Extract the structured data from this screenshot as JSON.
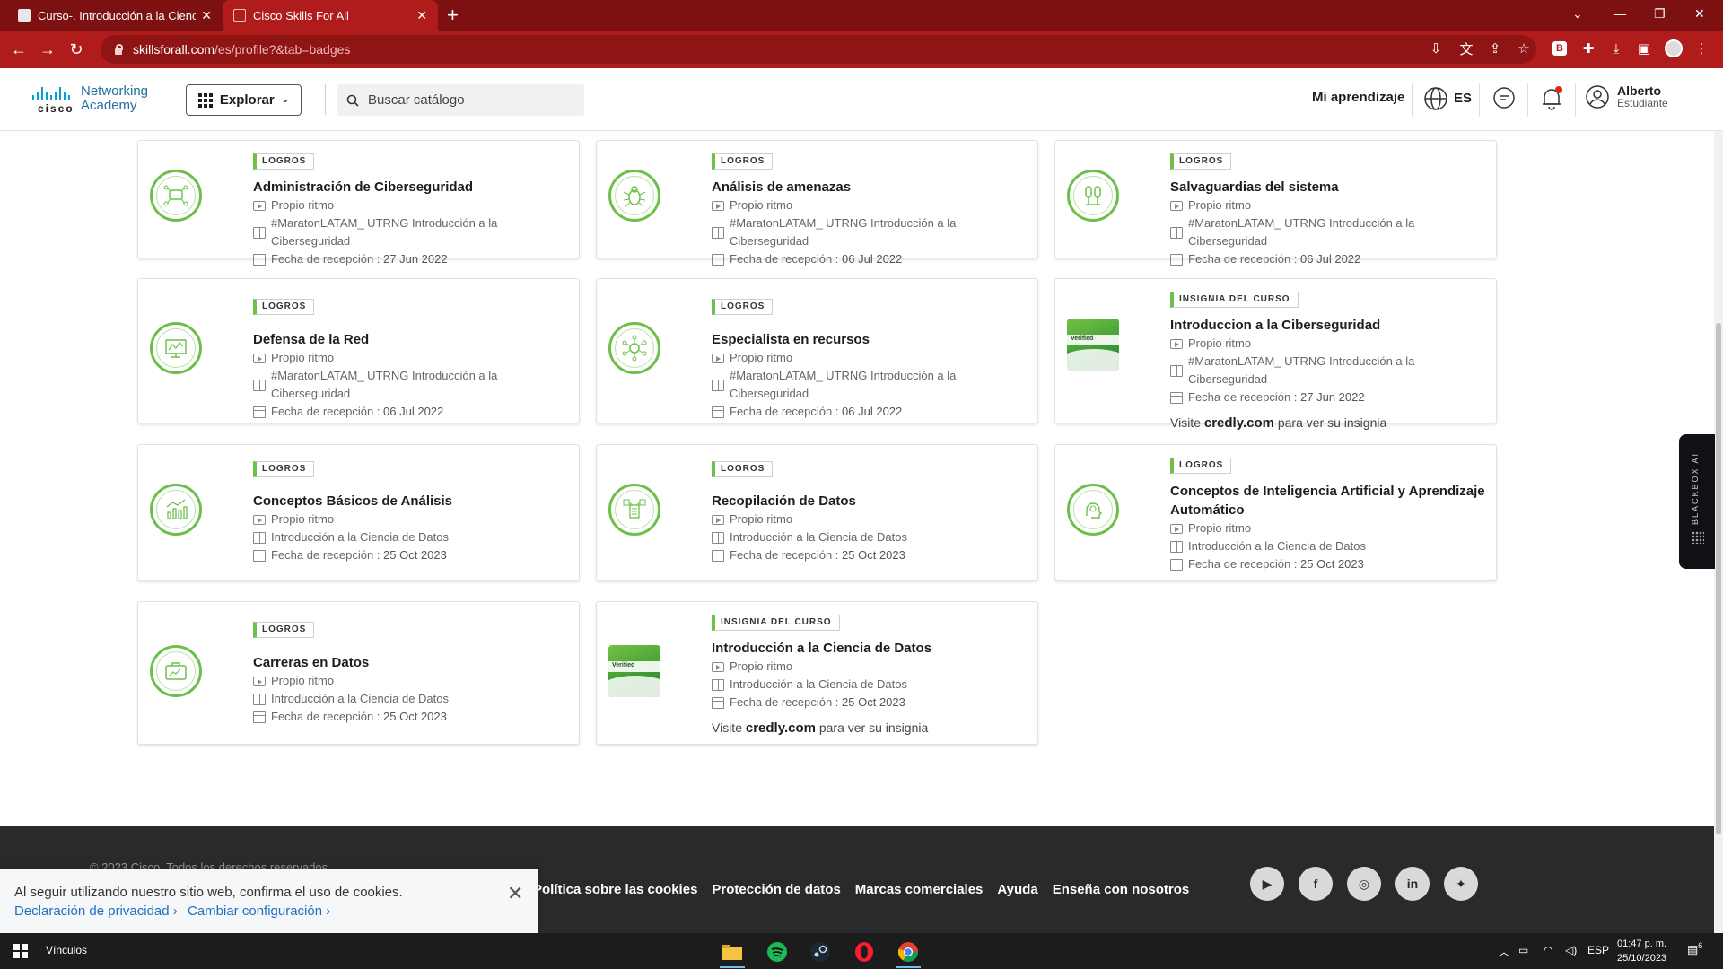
{
  "browser": {
    "tabs": [
      {
        "title": "Curso-. Introducción a la Ciencia",
        "active": false
      },
      {
        "title": "Cisco Skills For All",
        "active": true
      }
    ],
    "url_host": "skillsforall.com",
    "url_path": "/es/profile?&tab=badges",
    "accent_color": "#b01b1b"
  },
  "header": {
    "logo_word": "cisco",
    "logo_name_1": "Networking",
    "logo_name_2": "Academy",
    "explore_label": "Explorar",
    "search_placeholder": "Buscar catálogo",
    "my_learning": "Mi aprendizaje",
    "language": "ES",
    "user_name": "Alberto",
    "user_role": "Estudiante"
  },
  "cards": [
    {
      "tag": "LOGROS",
      "title": "Administración de Ciberseguridad",
      "pace": "Propio ritmo",
      "course": "#MaratonLATAM_ UTRNG Introducción a la Ciberseguridad",
      "date_label": "Fecha de recepción :",
      "date": "27 Jun 2022",
      "icon": "network-security-icon"
    },
    {
      "tag": "LOGROS",
      "title": "Análisis de amenazas",
      "pace": "Propio ritmo",
      "course": "#MaratonLATAM_ UTRNG Introducción a la Ciberseguridad",
      "date_label": "Fecha de recepción :",
      "date": "06 Jul 2022",
      "icon": "bug-icon"
    },
    {
      "tag": "LOGROS",
      "title": "Salvaguardias del sistema",
      "pace": "Propio ritmo",
      "course": "#MaratonLATAM_ UTRNG Introducción a la Ciberseguridad",
      "date_label": "Fecha de recepción :",
      "date": "06 Jul 2022",
      "icon": "safeguard-icon"
    },
    {
      "tag": "LOGROS",
      "title": "Defensa de la Red",
      "pace": "Propio ritmo",
      "course": "#MaratonLATAM_ UTRNG Introducción a la Ciberseguridad",
      "date_label": "Fecha de recepción :",
      "date": "06 Jul 2022",
      "icon": "monitor-icon"
    },
    {
      "tag": "LOGROS",
      "title": "Especialista en recursos",
      "pace": "Propio ritmo",
      "course": "#MaratonLATAM_ UTRNG Introducción a la Ciberseguridad",
      "date_label": "Fecha de recepción :",
      "date": "06 Jul 2022",
      "icon": "resources-hub-icon"
    },
    {
      "tag": "INSIGNIA DEL CURSO",
      "title": "Introduccion a la Ciberseguridad",
      "pace": "Propio ritmo",
      "course": "#MaratonLATAM_ UTRNG Introducción a la Ciberseguridad",
      "date_label": "Fecha de recepción :",
      "date": "27 Jun 2022",
      "icon": "course-badge-icon",
      "visit_pre": "Visite",
      "visit_site": "credly.com",
      "visit_post": "para ver su insignia"
    },
    {
      "tag": "LOGROS",
      "title": "Conceptos Básicos de Análisis",
      "pace": "Propio ritmo",
      "course": "Introducción a la Ciencia de Datos",
      "date_label": "Fecha de recepción :",
      "date": "25 Oct 2023",
      "icon": "chart-icon"
    },
    {
      "tag": "LOGROS",
      "title": "Recopilación de Datos",
      "pace": "Propio ritmo",
      "course": "Introducción a la Ciencia de Datos",
      "date_label": "Fecha de recepción :",
      "date": "25 Oct 2023",
      "icon": "data-collection-icon"
    },
    {
      "tag": "LOGROS",
      "title": "Conceptos de Inteligencia Artificial y Aprendizaje Automático",
      "pace": "Propio ritmo",
      "course": "Introducción a la Ciencia de Datos",
      "date_label": "Fecha de recepción :",
      "date": "25 Oct 2023",
      "icon": "ai-brain-icon"
    },
    {
      "tag": "LOGROS",
      "title": "Carreras en Datos",
      "pace": "Propio ritmo",
      "course": "Introducción a la Ciencia de Datos",
      "date_label": "Fecha de recepción :",
      "date": "25 Oct 2023",
      "icon": "briefcase-icon"
    },
    {
      "tag": "INSIGNIA DEL CURSO",
      "title": "Introducción a la Ciencia de Datos",
      "pace": "Propio ritmo",
      "course": "Introducción a la Ciencia de Datos",
      "date_label": "Fecha de recepción :",
      "date": "25 Oct 2023",
      "icon": "course-badge-icon",
      "visit_pre": "Visite",
      "visit_site": "credly.com",
      "visit_post": "para ver su insignia"
    }
  ],
  "floating_tab": "BLACKBOX AI",
  "footer": {
    "copyright": "© 2023 Cisco. Todos los derechos reservados.",
    "links": [
      "Política sobre las cookies",
      "Protección de datos",
      "Marcas comerciales",
      "Ayuda",
      "Enseña con nosotros"
    ],
    "social": [
      "youtube-icon",
      "facebook-icon",
      "instagram-icon",
      "linkedin-icon",
      "twitter-icon"
    ],
    "bg_color": "#292a2c"
  },
  "cookie": {
    "message": "Al seguir utilizando nuestro sitio web, confirma el uso de cookies.",
    "privacy_link": "Declaración de privacidad",
    "settings_link": "Cambiar configuración"
  },
  "taskbar": {
    "label": "Vínculos",
    "language": "ESP",
    "time": "01:47 p. m.",
    "date": "25/10/2023",
    "notification_count": "6"
  },
  "brand_green": "#6cc04a"
}
